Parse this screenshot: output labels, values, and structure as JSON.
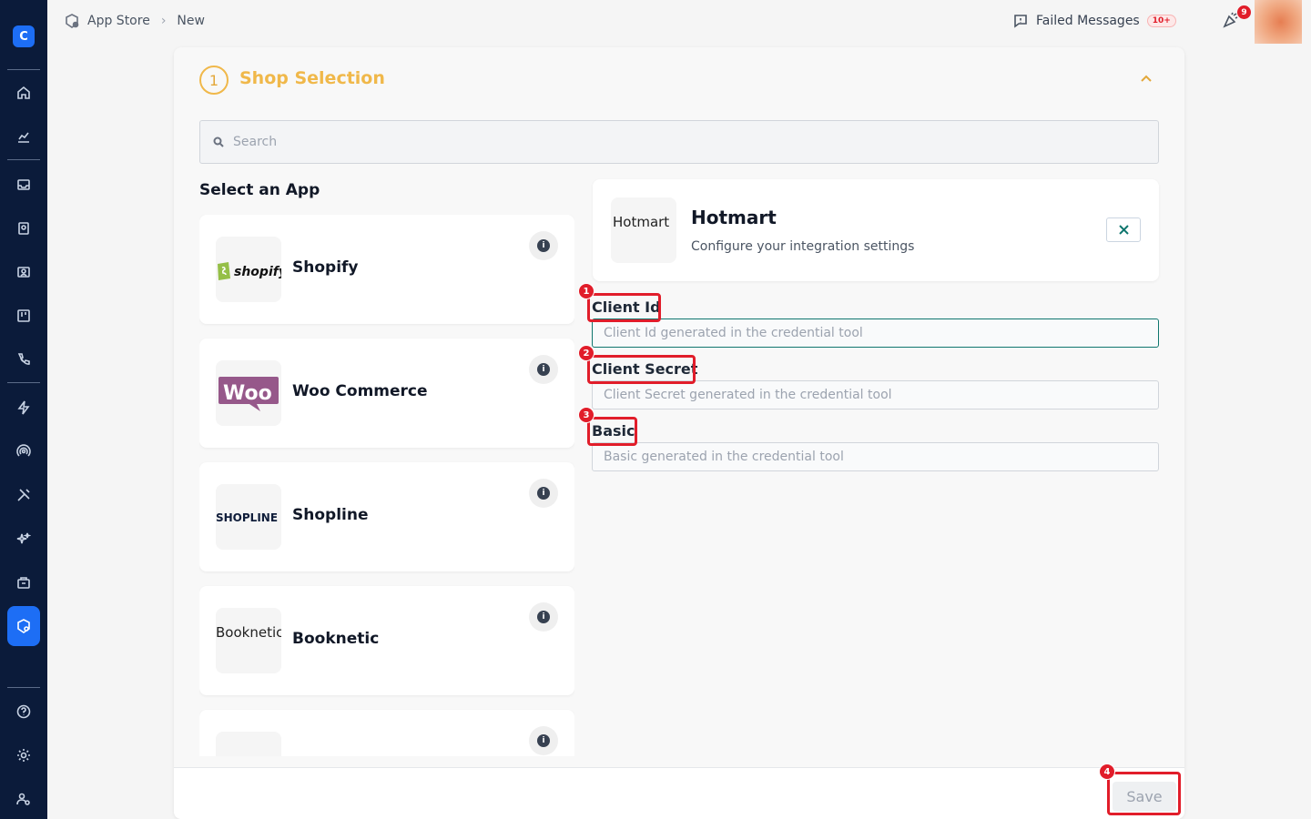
{
  "sidebar": {
    "logo": "C",
    "items": [
      {
        "icon": "home-icon"
      },
      {
        "icon": "analytics-icon"
      },
      {
        "icon": "inbox-icon"
      },
      {
        "icon": "contacts-icon"
      },
      {
        "icon": "broadcast-icon"
      },
      {
        "icon": "board-icon"
      },
      {
        "icon": "phone-icon"
      },
      {
        "icon": "automation-icon"
      },
      {
        "icon": "signal-icon"
      },
      {
        "icon": "tools-icon"
      },
      {
        "icon": "ai-sparkle-icon"
      },
      {
        "icon": "commerce-icon"
      },
      {
        "icon": "app-store-icon",
        "active": true
      },
      {
        "icon": "help-icon"
      },
      {
        "icon": "settings-icon"
      },
      {
        "icon": "user-settings-icon"
      }
    ]
  },
  "topbar": {
    "breadcrumb": [
      "App Store",
      "New"
    ],
    "failed_messages_label": "Failed Messages",
    "failed_messages_badge": "10+",
    "notification_count": "9"
  },
  "step": {
    "number": "1",
    "title": "Shop Selection"
  },
  "search": {
    "placeholder": "Search"
  },
  "apps": {
    "title": "Select an App",
    "list": [
      {
        "name": "Shopify",
        "logo_text": "shopify"
      },
      {
        "name": "Woo Commerce",
        "logo_text": "Woo"
      },
      {
        "name": "Shopline",
        "logo_text": "SHOPLINE"
      },
      {
        "name": "Booknetic",
        "logo_text": "Booknetic"
      },
      {
        "name": "",
        "logo_text": ""
      }
    ]
  },
  "detail": {
    "logo_alt": "Hotmart",
    "name": "Hotmart",
    "subtitle": "Configure your integration settings"
  },
  "form": {
    "client_id_label": "Client Id",
    "client_id_placeholder": "Client Id generated in the credential tool",
    "client_secret_label": "Client Secret",
    "client_secret_placeholder": "Client Secret generated in the credential tool",
    "basic_label": "Basic",
    "basic_placeholder": "Basic generated in the credential tool"
  },
  "footer": {
    "save_label": "Save"
  },
  "annotations": [
    "1",
    "2",
    "3",
    "4"
  ],
  "colors": {
    "sidebar_bg": "#0b1b3a",
    "accent": "#1d6ef5",
    "step_color": "#f0b84a",
    "annotation_red": "#e11d2a",
    "focus_border": "#0f766e"
  }
}
